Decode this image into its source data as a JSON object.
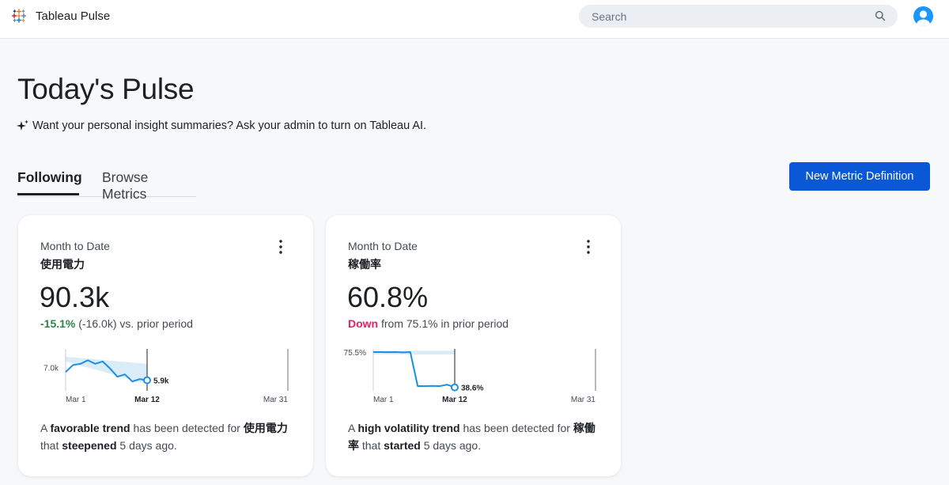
{
  "app": {
    "title": "Tableau Pulse"
  },
  "search": {
    "placeholder": "Search"
  },
  "page": {
    "title": "Today's Pulse",
    "ai_note": "Want your personal insight summaries? Ask your admin to turn on Tableau AI."
  },
  "tabs": [
    {
      "label": "Following",
      "active": true
    },
    {
      "label": "Browse Metrics",
      "active": false
    }
  ],
  "new_metric_label": "New Metric Definition",
  "colors": {
    "accent": "#0b58d6",
    "positive": "#2e844a",
    "negative": "#ea1e63",
    "line": "#1a8fe3",
    "band": "#daecf8"
  },
  "cards": [
    {
      "period": "Month to Date",
      "name": "使用電力",
      "value": "90.3k",
      "change_main": "-15.1%",
      "change_rest": " (-16.0k) vs. prior period",
      "insight": {
        "p1": "A ",
        "b1": "favorable trend",
        "p2": " has been detected for ",
        "b2": "使用電力",
        "p3": " that ",
        "b3": "steepened",
        "p4": " 5 days ago."
      },
      "chart_data": {
        "type": "line",
        "x": [
          "Mar 1",
          "Mar 2",
          "Mar 3",
          "Mar 4",
          "Mar 5",
          "Mar 6",
          "Mar 7",
          "Mar 8",
          "Mar 9",
          "Mar 10",
          "Mar 11",
          "Mar 12"
        ],
        "y": [
          6.6,
          7.2,
          7.3,
          7.6,
          7.3,
          7.5,
          6.9,
          6.2,
          6.4,
          5.8,
          6.0,
          5.9
        ],
        "ylim": [
          5.0,
          8.5
        ],
        "ytick_label": "7.0k",
        "ytick_value": 7.0,
        "xtick_labels": [
          "Mar 1",
          "Mar 12",
          "Mar 31"
        ],
        "end_label": "5.9k",
        "band_start": [
          7.5,
          7.9
        ],
        "band_end": [
          5.6,
          7.3
        ]
      }
    },
    {
      "period": "Month to Date",
      "name": "稼働率",
      "value": "60.8%",
      "change_main": "Down",
      "change_rest": " from 75.1% in prior period",
      "insight": {
        "p1": "A ",
        "b1": "high volatility trend",
        "p2": " has been detected for ",
        "b2": "稼働率",
        "p3": " that ",
        "b3": "started",
        "p4": " 5 days ago."
      },
      "chart_data": {
        "type": "line",
        "x": [
          "Mar 1",
          "Mar 2",
          "Mar 3",
          "Mar 4",
          "Mar 5",
          "Mar 6",
          "Mar 7",
          "Mar 8",
          "Mar 9",
          "Mar 10",
          "Mar 11",
          "Mar 12"
        ],
        "y": [
          75.5,
          75.5,
          75.4,
          75.5,
          75.2,
          75.5,
          40.0,
          40.0,
          40.2,
          40.0,
          41.5,
          38.6
        ],
        "ylim": [
          35.0,
          78.0
        ],
        "ytick_label": "75.5%",
        "ytick_value": 75.5,
        "xtick_labels": [
          "Mar 1",
          "Mar 12",
          "Mar 31"
        ],
        "end_label": "38.6%",
        "band_start": [
          73.0,
          77.0
        ],
        "band_end": [
          73.0,
          77.0
        ]
      }
    }
  ]
}
